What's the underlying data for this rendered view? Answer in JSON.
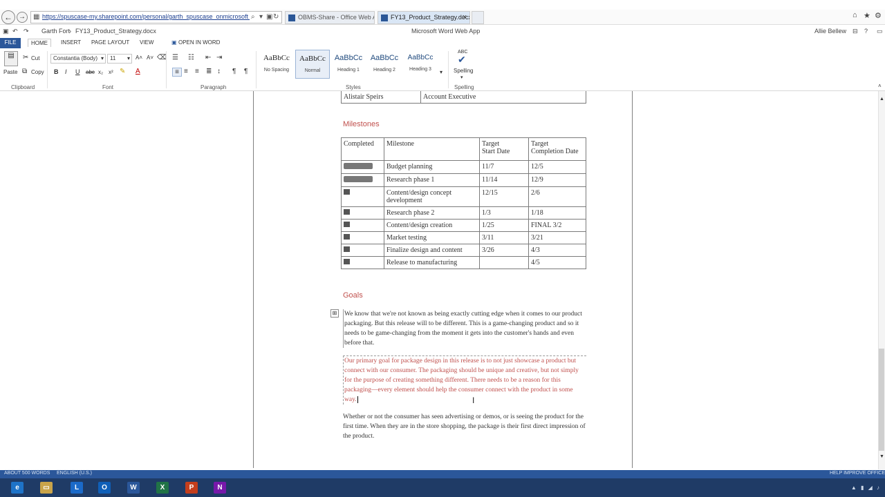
{
  "browser": {
    "url": "https://spuscase-my.sharepoint.com/personal/garth_spuscase_onmicrosoft_com/...",
    "tabs": [
      {
        "label": "OBMS-Share - Office Web Apps"
      },
      {
        "label": "FY13_Product_Strategy.docx"
      }
    ]
  },
  "titlebar": {
    "breadcrumb_user": "Garth Fort",
    "breadcrumb_sep": "›",
    "document_name": "FY13_Product_Strategy.docx",
    "app_name": "Microsoft Word Web App",
    "signed_in_user": "Allie Bellew"
  },
  "ribbon_tabs": [
    "FILE",
    "HOME",
    "INSERT",
    "PAGE LAYOUT",
    "VIEW",
    "OPEN IN WORD"
  ],
  "ribbon": {
    "clipboard": {
      "paste": "Paste",
      "cut": "Cut",
      "copy": "Copy",
      "label": "Clipboard"
    },
    "font": {
      "name": "Constantia (Body)",
      "size": "11",
      "label": "Font"
    },
    "paragraph": {
      "label": "Paragraph"
    },
    "styles": {
      "items": [
        {
          "sample": "AaBbCc",
          "name": "No Spacing"
        },
        {
          "sample": "AaBbCc",
          "name": "Normal"
        },
        {
          "sample": "AaBbCc",
          "name": "Heading 1"
        },
        {
          "sample": "AaBbCc",
          "name": "Heading 2"
        },
        {
          "sample": "AaBbCc",
          "name": "Heading 3"
        }
      ],
      "label": "Styles"
    },
    "spelling": {
      "abc": "ABC",
      "button": "Spelling",
      "label": "Spelling"
    }
  },
  "doc": {
    "top_row": [
      "Alistair Speirs",
      "Account Executive"
    ],
    "milestones_heading": "Milestones",
    "milestones_headers": [
      "Completed",
      "Milestone",
      "Target\nStart Date",
      "Target\nCompletion Date"
    ],
    "milestones_rows": [
      {
        "done": true,
        "name": "Budget planning",
        "start": "11/7",
        "end": "12/5"
      },
      {
        "done": true,
        "name": "Research phase 1",
        "start": "11/14",
        "end": "12/9"
      },
      {
        "done": false,
        "name": "Content/design concept development",
        "start": "12/15",
        "end": "2/6"
      },
      {
        "done": false,
        "name": "Research phase 2",
        "start": "1/3",
        "end": "1/18"
      },
      {
        "done": false,
        "name": "Content/design creation",
        "start": "1/25",
        "end": "FINAL 3/2"
      },
      {
        "done": false,
        "name": "Market testing",
        "start": "3/11",
        "end": "3/21"
      },
      {
        "done": false,
        "name": "Finalize design and content",
        "start": "3/26",
        "end": "4/3"
      },
      {
        "done": false,
        "name": "Release to manufacturing",
        "start": "",
        "end": "4/5"
      }
    ],
    "goals_heading": "Goals",
    "goals_p1": "We know that we're not known as being exactly cutting edge when it comes to our product packaging. But this release will to be different. This is a game-changing product and so it needs to be game-changing from the moment it gets into the customer's hands and even before that.",
    "goals_p2": "Our primary goal for package design in this release is to not just showcase a product but connect with our consumer. The packaging should be unique and creative, but not simply for the purpose of creating something different. There needs to be a reason for this packaging—every element should help the consumer connect with the product in some way.",
    "goals_p3": "Whether or not the consumer has seen advertising or demos, or is seeing the product for the first time. When they are in the store shopping, the package is their first direct impression of the product."
  },
  "status": {
    "left": "ABOUT 500 WORDS",
    "language": "ENGLISH (U.S.)",
    "right": "HELP IMPROVE OFFICE"
  },
  "taskbar": {
    "items": [
      {
        "letter": "e",
        "color": "#1e73c8"
      },
      {
        "letter": "▭",
        "color": "#c9a44a"
      },
      {
        "letter": "L",
        "color": "#1b6ac9"
      },
      {
        "letter": "O",
        "color": "#0f5fb8"
      },
      {
        "letter": "W",
        "color": "#2b579a"
      },
      {
        "letter": "X",
        "color": "#217346"
      },
      {
        "letter": "P",
        "color": "#c43e1c"
      },
      {
        "letter": "N",
        "color": "#7719aa"
      }
    ]
  },
  "colors": {
    "word_blue": "#2b579a",
    "heading_red": "#c0504d"
  }
}
